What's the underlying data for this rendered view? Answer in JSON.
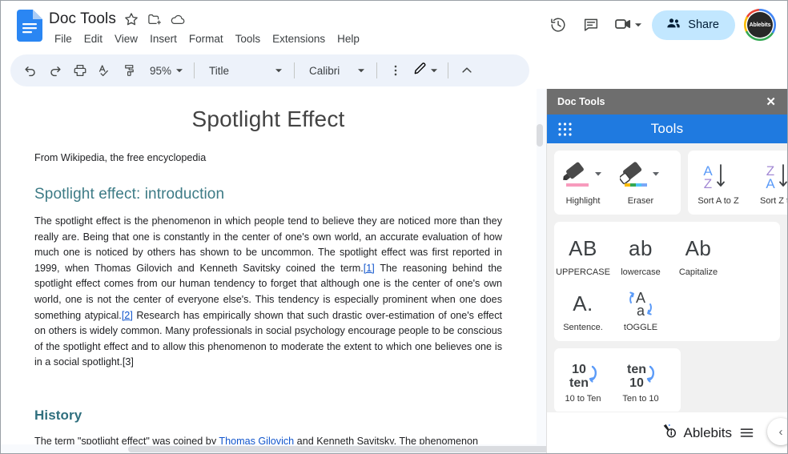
{
  "app": {
    "doc_title": "Doc Tools",
    "menus": [
      "File",
      "Edit",
      "View",
      "Insert",
      "Format",
      "Tools",
      "Extensions",
      "Help"
    ],
    "title_icons": [
      "star-icon",
      "move-to-folder-icon",
      "cloud-saved-icon"
    ],
    "share_label": "Share",
    "avatar_label": "Ablebits",
    "right_icons": [
      "version-history-icon",
      "comments-icon",
      "meet-icon"
    ]
  },
  "toolbar": {
    "undo": "undo-icon",
    "redo": "redo-icon",
    "print": "print-icon",
    "spellcheck": "spellcheck-icon",
    "paint_format": "paint-format-icon",
    "zoom_value": "95%",
    "style_value": "Title",
    "font_value": "Calibri",
    "more_options": "more-vertical-icon",
    "edit_mode": "pencil-icon",
    "collapse": "chevron-up-icon"
  },
  "document": {
    "title": "Spotlight Effect",
    "subtitle": "From Wikipedia, the free encyclopedia",
    "heading1": "Spotlight effect: introduction",
    "p1_a": "The spotlight effect is the phenomenon in which people tend to believe they are noticed more than they really are. Being that one is constantly in the center of one's own world, an accurate evaluation of how much one is noticed by others has shown to be uncommon. The spotlight effect was first reported in 1999, when Thomas Gilovich and Kenneth Savitsky coined the term.",
    "ref1": "[1]",
    "p1_b": " The reasoning behind the spotlight effect comes from our human tendency to forget that although one is the center of one's own world, one is not the center of everyone else's. This tendency is especially prominent when one does something atypical.",
    "ref2": "[2]",
    "p1_c": " Research has empirically shown that such drastic over-estimation of one's effect on others is widely common. Many professionals in social psychology encourage people to be conscious of the spotlight effect and to allow this phenomenon to moderate the extent to which one believes one is in a social spotlight.[3]",
    "heading2": "History",
    "p2_a": "The term \"spotlight effect\" was coined by ",
    "p2_link": "Thomas Gilovich",
    "p2_b": " and Kenneth Savitsky. The phenomenon"
  },
  "sidebar": {
    "header_title": "Doc Tools",
    "close_icon": "✕",
    "blue_title": "Tools",
    "grid_icon": "apps-grid-icon",
    "groups": [
      {
        "name": "highlight-group",
        "tools": [
          {
            "label": "Highlight",
            "icon": "highlight-marker-icon",
            "has_dropdown": true
          },
          {
            "label": "Eraser",
            "icon": "eraser-icon",
            "has_dropdown": true
          }
        ]
      },
      {
        "name": "sort-group",
        "tools": [
          {
            "label": "Sort A to Z",
            "icon": "sort-az-icon",
            "has_dropdown": false
          },
          {
            "label": "Sort Z to A",
            "icon": "sort-za-icon",
            "has_dropdown": false
          }
        ]
      },
      {
        "name": "case-group",
        "tools": [
          {
            "label": "UPPERCASE",
            "icon": "AB",
            "has_dropdown": false
          },
          {
            "label": "lowercase",
            "icon": "ab",
            "has_dropdown": false
          },
          {
            "label": "Capitalize",
            "icon": "Ab",
            "has_dropdown": false
          },
          {
            "label": "Sentence.",
            "icon": "A.",
            "has_dropdown": false
          },
          {
            "label": "tOGGLE",
            "icon": "toggle-case-icon",
            "has_dropdown": false
          }
        ]
      },
      {
        "name": "number-group",
        "tools": [
          {
            "label": "10 to Ten",
            "icon": "number-to-word-icon",
            "top": "10",
            "bottom": "ten"
          },
          {
            "label": "Ten to 10",
            "icon": "word-to-number-icon",
            "top": "ten",
            "bottom": "10"
          }
        ]
      }
    ],
    "footer_brand": "Ablebits",
    "footer_info_icon": "info-icon",
    "footer_menu_icon": "hamburger-icon",
    "collapse_icon": "‹"
  },
  "colors": {
    "blue_bar": "#1f7ae0",
    "sidebar_header": "#6e6e6e",
    "share_bg": "#c2e7ff",
    "toolbar_bg": "#edf2fa",
    "heading_teal": "#3d7b86",
    "link_blue": "#1155cc",
    "highlight_pink": "#f8a5c2"
  }
}
